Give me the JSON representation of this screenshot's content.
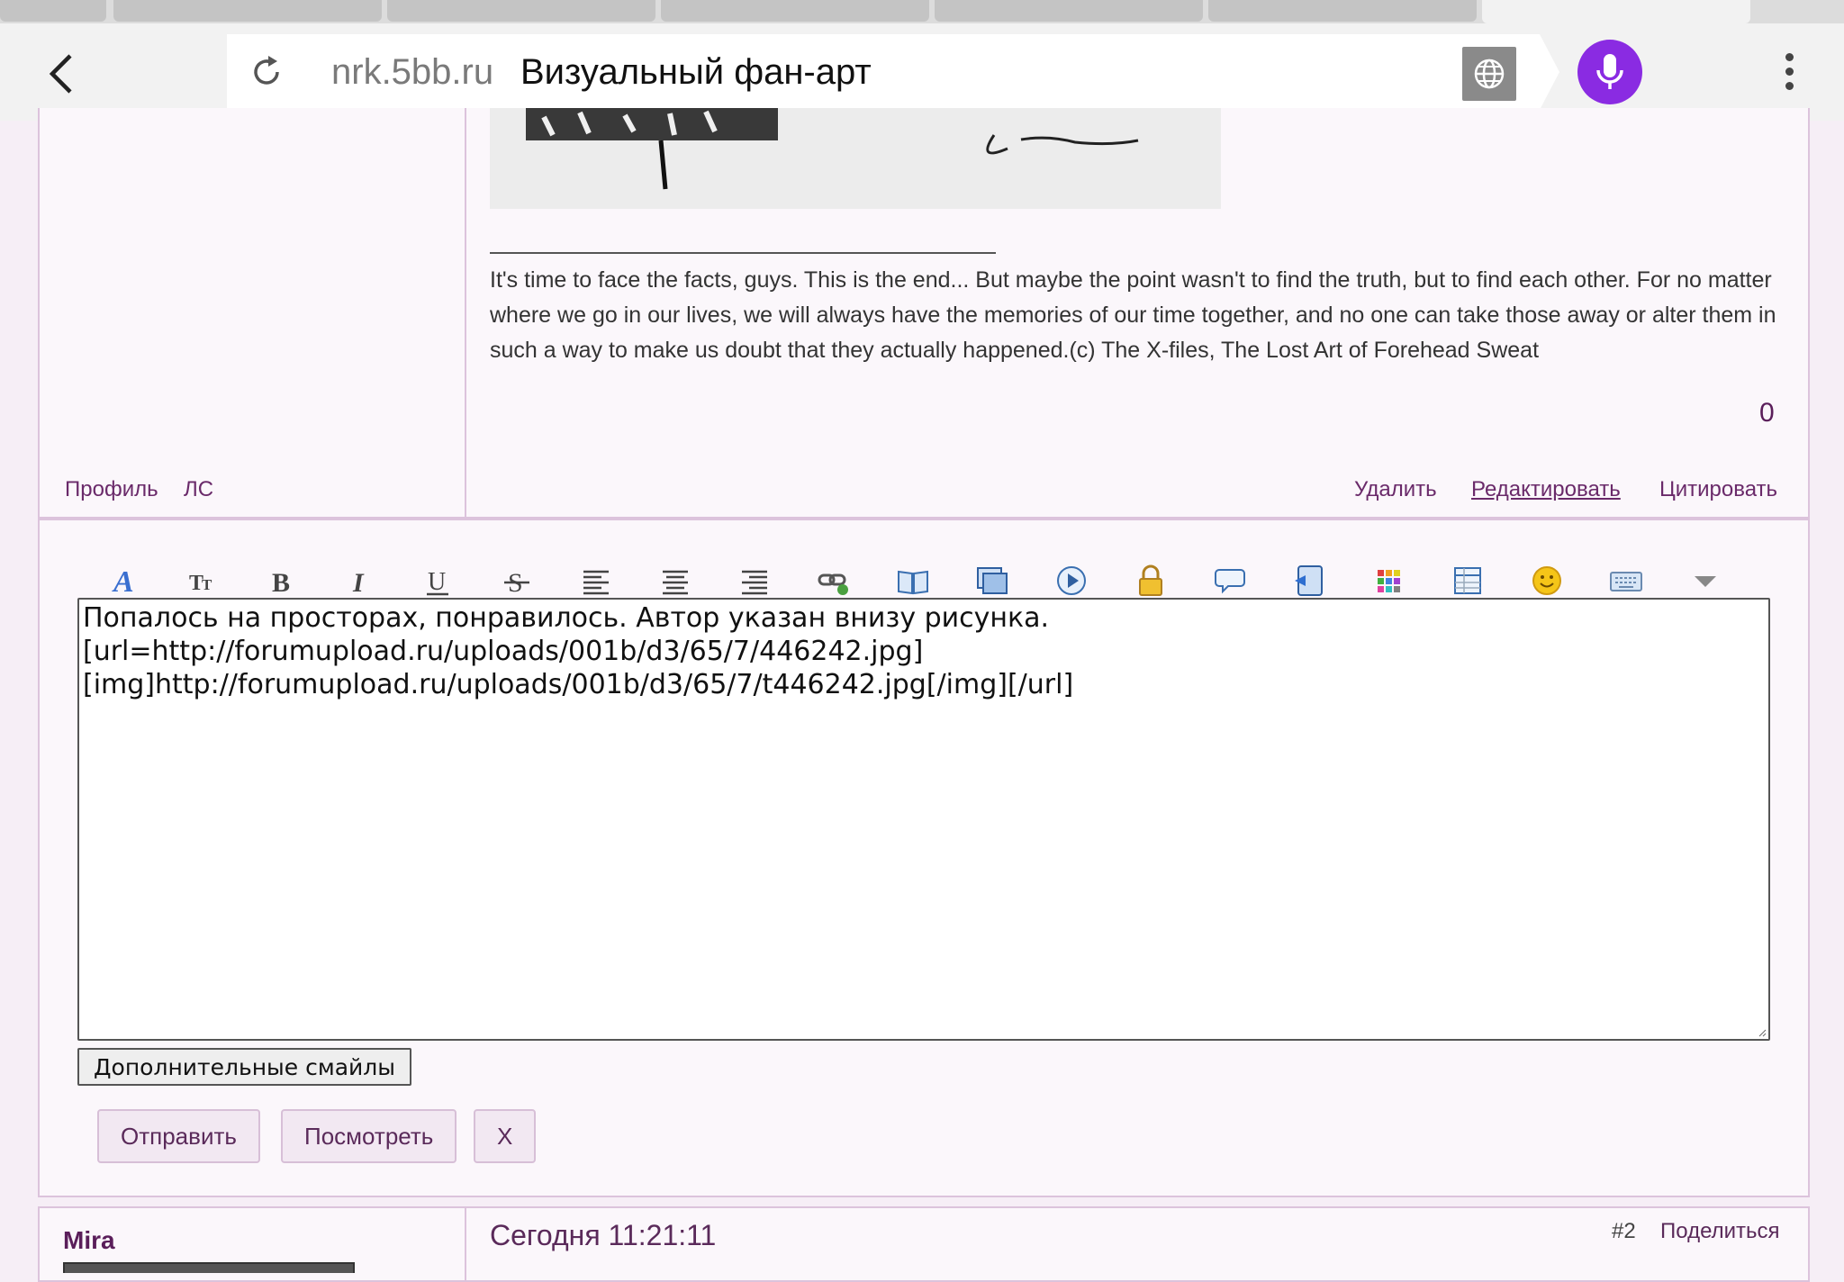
{
  "browser": {
    "domain": "nrk.5bb.ru",
    "page_title": "Визуальный фан-арт",
    "accent_color": "#8a2be2"
  },
  "post": {
    "signature": "It's time to face the facts, guys. This is the end... But maybe the point wasn't to find the truth, but to find each other. For no matter where we go in our lives, we will always have the memories of our time together, and no one can take those away or alter them in such a way to make us doubt that they actually happened.(c) The X-files, The Lost Art of Forehead Sweat",
    "counter": "0",
    "profile_link": "Профиль",
    "pm_link": "ЛС",
    "delete": "Удалить",
    "edit": "Редактировать",
    "quote": "Цитировать"
  },
  "editor": {
    "toolbar_icons": [
      "font-color-icon",
      "font-size-icon",
      "bold-icon",
      "italic-icon",
      "underline-icon",
      "strikethrough-icon",
      "align-left-icon",
      "align-center-icon",
      "align-right-icon",
      "link-icon",
      "book-icon",
      "image-icon",
      "video-icon",
      "lock-icon",
      "speech-bubble-icon",
      "edit-script-icon",
      "color-grid-icon",
      "table-icon",
      "smiley-icon",
      "keyboard-icon",
      "more-dropdown-icon"
    ],
    "text": "Попалось на просторах, понравилось. Автор указан внизу рисунка.\n[url=http://forumupload.ru/uploads/001b/d3/65/7/446242.jpg]\n[img]http://forumupload.ru/uploads/001b/d3/65/7/t446242.jpg[/img][/url]",
    "more_smiles": "Дополнительные смайлы",
    "send": "Отправить",
    "preview": "Посмотреть",
    "close": "X"
  },
  "next_post": {
    "author": "Mira",
    "time": "Сегодня 11:21:11",
    "number": "#2",
    "share": "Поделиться"
  }
}
